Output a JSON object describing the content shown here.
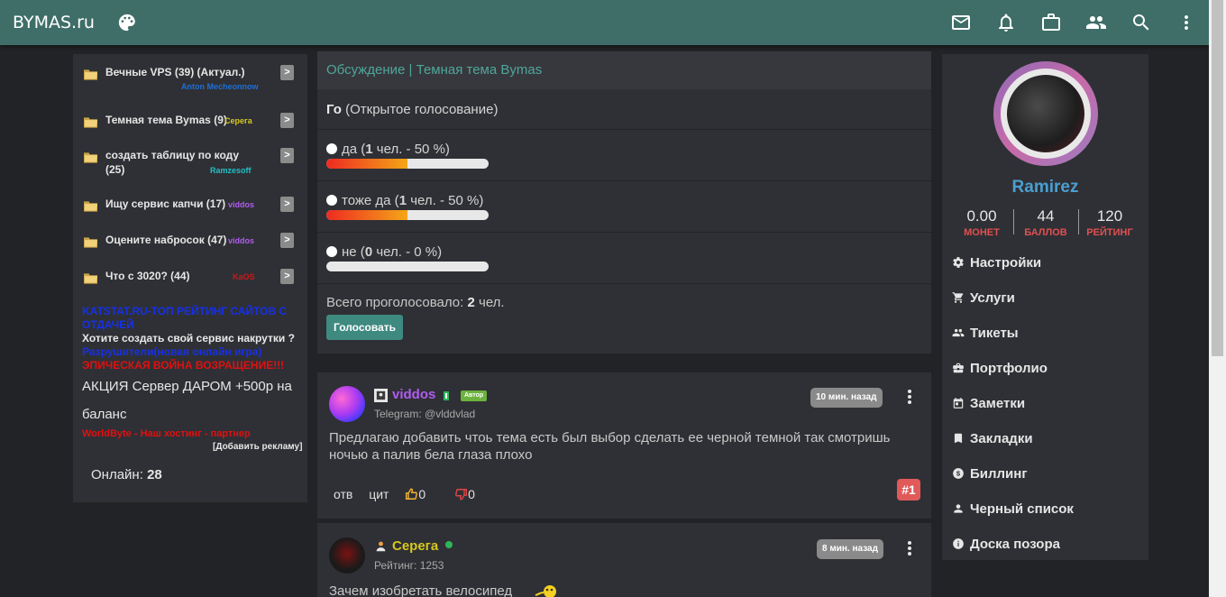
{
  "header": {
    "brand": "BYMAS.ru",
    "icons": [
      "palette-icon",
      "mail-icon",
      "bell-icon",
      "briefcase-icon",
      "people-icon",
      "search-icon",
      "more-vert-icon"
    ]
  },
  "left": {
    "items": [
      {
        "title": "Вечные VPS (39) (Актуал.)",
        "author": "Anton Mecheonnow",
        "author_color": "#1f6fd6"
      },
      {
        "title": "Темная тема Bymas (9)",
        "author": "Серега",
        "author_color": "#d6c81f"
      },
      {
        "title": "создать таблицу по коду (25)",
        "author": "Ramzesoff",
        "author_color": "#20c0c8"
      },
      {
        "title": "Ищу сервис капчи (17)",
        "author": "viddos",
        "author_color": "#b05cf0"
      },
      {
        "title": "Оцените набросок (47)",
        "author": "viddos",
        "author_color": "#b05cf0"
      },
      {
        "title": "Что с 3020? (44)",
        "author": "KaOS",
        "author_color": "#d01818"
      }
    ],
    "arrow": ">",
    "ads": [
      "KATSTAT.RU-ТОП РЕЙТИНГ САЙТОВ С ОТДАЧЕЙ",
      "Хотите создать свой сервис накрутки ?",
      "Разрушители(новая онлайн игра)",
      "ЭПИЧЕСКАЯ ВОЙНА ВОЗРАЩЕНИЕ!!!"
    ],
    "promo": "АКЦИЯ Сервер ДАРОМ +500р на баланс",
    "worldbyte": "WorldByte - Наш хостинг - партнер",
    "add_ad": "[Добавить рекламу]",
    "online_label": "Онлайн:",
    "online_count": "28"
  },
  "poll": {
    "heading": "Обсуждение | Темная тема Bymas",
    "question_bold": "Го",
    "question_rest": "(Открытое голосование)",
    "options": [
      {
        "label": "да",
        "count": "1",
        "percent": "50",
        "fill": 0.5
      },
      {
        "label": "тоже да",
        "count": "1",
        "percent": "50",
        "fill": 0.5
      },
      {
        "label": "не",
        "count": "0",
        "percent": "0",
        "fill": 0
      }
    ],
    "people_suffix": "чел. -",
    "percent_suffix": "%)",
    "total_label": "Всего проголосовало:",
    "total_count": "2",
    "total_suffix": "чел.",
    "vote_button": "Голосовать"
  },
  "posts": [
    {
      "user": "viddos",
      "user_color": "#b05cf0",
      "badge": "Автор",
      "sub": "Telegram: @vlddvlad",
      "time": "10 мин. назад",
      "text": "Предлагаю добавить чтоь тема есть был выбор сделать ее черной темной так смотришь ночью а палив бела глаза плохо",
      "reply": "отв",
      "quote": "цит",
      "likes": "0",
      "dislikes": "0",
      "number": "#1"
    },
    {
      "user": "Серега",
      "user_color": "#d6c81f",
      "sub": "Рейтинг: 1253",
      "time": "8 мин. назад",
      "text": "Зачем изобретать велосипед"
    }
  ],
  "profile": {
    "name": "Ramirez",
    "stats": [
      {
        "value": "0.00",
        "label": "МОНЕТ"
      },
      {
        "value": "44",
        "label": "БАЛЛОВ"
      },
      {
        "value": "120",
        "label": "РЕЙТИНГ"
      }
    ],
    "menu": [
      {
        "label": "Настройки",
        "icon": "gear-icon"
      },
      {
        "label": "Услуги",
        "icon": "cart-icon"
      },
      {
        "label": "Тикеты",
        "icon": "people-icon"
      },
      {
        "label": "Портфолио",
        "icon": "briefcase-icon"
      },
      {
        "label": "Заметки",
        "icon": "calendar-icon"
      },
      {
        "label": "Закладки",
        "icon": "bookmark-icon"
      },
      {
        "label": "Биллинг",
        "icon": "coin-icon"
      },
      {
        "label": "Черный список",
        "icon": "person-icon"
      },
      {
        "label": "Доска позора",
        "icon": "info-icon"
      }
    ]
  }
}
